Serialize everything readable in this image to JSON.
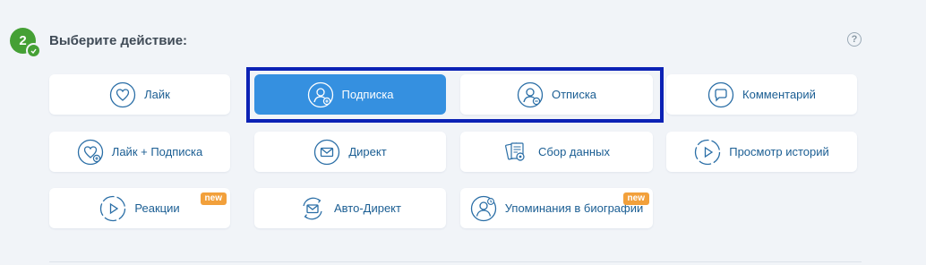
{
  "step": {
    "number": "2",
    "title": "Выберите действие:",
    "help_glyph": "?"
  },
  "actions": [
    {
      "label": "Лайк",
      "icon": "heart-icon",
      "selected": false
    },
    {
      "label": "Подписка",
      "icon": "user-add-icon",
      "selected": true
    },
    {
      "label": "Отписка",
      "icon": "user-remove-icon",
      "selected": false
    },
    {
      "label": "Комментарий",
      "icon": "comment-icon",
      "selected": false
    },
    {
      "label": "Лайк + Подписка",
      "icon": "heart-plus-icon",
      "selected": false
    },
    {
      "label": "Директ",
      "icon": "envelope-icon",
      "selected": false
    },
    {
      "label": "Сбор данных",
      "icon": "data-collect-icon",
      "selected": false
    },
    {
      "label": "Просмотр историй",
      "icon": "story-play-icon",
      "selected": false
    },
    {
      "label": "Реакции",
      "icon": "reaction-play-icon",
      "selected": false,
      "badge": "new"
    },
    {
      "label": "Авто-Директ",
      "icon": "auto-envelope-icon",
      "selected": false
    },
    {
      "label": "Упоминания в биографии",
      "icon": "user-mention-icon",
      "selected": false,
      "badge": "new"
    }
  ],
  "colors": {
    "accent": "#3590e0",
    "text": "#1b5e93",
    "step_green": "#45a035",
    "badge_orange": "#f2a03b",
    "highlight_border": "#0c22b5",
    "background": "#f1f4f8"
  }
}
